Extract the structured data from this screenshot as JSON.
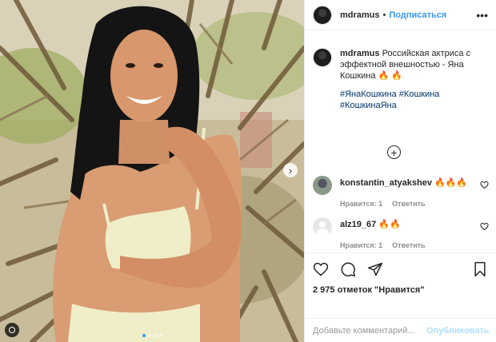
{
  "header": {
    "username": "mdramus",
    "separator": "•",
    "follow_label": "Подписаться",
    "more_icon": "more-horizontal-icon",
    "more_label": "•••"
  },
  "caption": {
    "username": "mdramus",
    "text": "Российская актриса с эффектной внешностью - Яна Кошкина 🔥 🔥",
    "hashtags": "#ЯнаКошкина #Кошкина #КошкинаЯна"
  },
  "load_more": {
    "icon": "plus-circle-icon",
    "label": "+"
  },
  "comments": [
    {
      "username": "konstantin_atyakshev",
      "text": "🔥🔥🔥",
      "likes_label": "Нравится: 1",
      "reply_label": "Ответить",
      "heart_icon": "heart-outline-icon"
    },
    {
      "username": "alz19_67",
      "text": "🔥🔥",
      "likes_label": "Нравится: 1",
      "reply_label": "Ответить",
      "heart_icon": "heart-outline-icon"
    }
  ],
  "actions": {
    "like_icon": "heart-icon",
    "comment_icon": "comment-icon",
    "share_icon": "paper-plane-icon",
    "save_icon": "bookmark-icon",
    "likes_text": "2 975 отметок \"Нравится\""
  },
  "add_comment": {
    "placeholder": "Добавьте комментарий...",
    "publish_label": "Опубликовать"
  },
  "photo": {
    "next_icon": "chevron-right-icon",
    "next_label": "›",
    "carousel_dot_count": 4,
    "active_dot": 1
  },
  "colors": {
    "link_blue": "#3897f0",
    "hashtag": "#003569",
    "publish_disabled": "#b2dffc",
    "muted": "#8e8e8e"
  }
}
